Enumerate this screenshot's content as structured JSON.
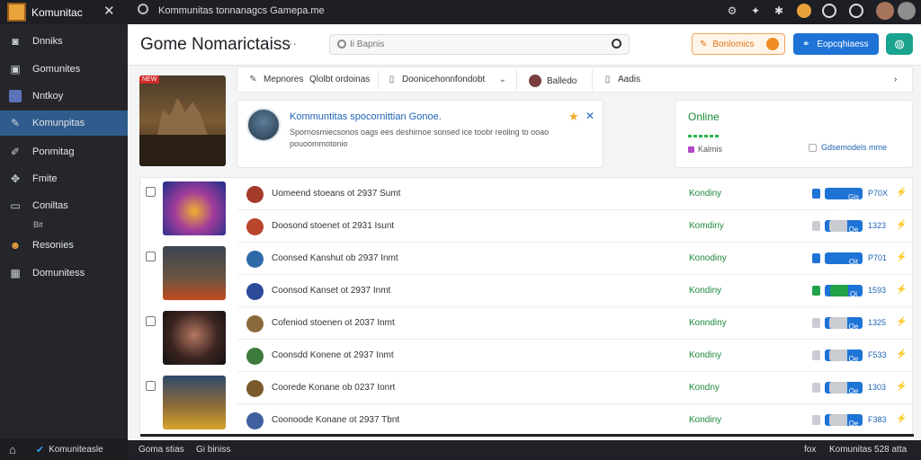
{
  "topbar": {
    "app_name": "Komunitac",
    "title": "Kommunitas tonnanagcs Gamepa.me"
  },
  "sidebar": {
    "items": [
      {
        "label": "Dnniks",
        "icon": "camera-icon"
      },
      {
        "label": "Gomunites",
        "icon": "tv-icon"
      },
      {
        "label": "Nntkoy",
        "icon": "image-icon"
      },
      {
        "label": "Komunpitas",
        "icon": "wrench-icon"
      },
      {
        "label": "Ponmitag",
        "icon": "pen-icon"
      },
      {
        "label": "Fmite",
        "icon": "gamepad-icon"
      },
      {
        "label": "Coniltas",
        "icon": "chat-icon"
      },
      {
        "label": "Resonies",
        "icon": "people-icon"
      },
      {
        "label": "Domunitess",
        "icon": "grid-icon"
      }
    ],
    "sub_label": "Bit",
    "footer_label": "Komuniteasle"
  },
  "bottombar": {
    "left1": "Goma stias",
    "left2": "Gi biniss",
    "right1": "fox",
    "right2": "Komunitas 528 atta"
  },
  "header": {
    "title": "Gome Nomarictaiss",
    "dots": "···",
    "search_placeholder": "Ii Bapnis",
    "btn_orange": "Bonlomics",
    "btn_blue": "Eopcqhiaess"
  },
  "featured": {
    "tag": "NEW"
  },
  "strip": {
    "items": [
      "Mepnores",
      "Qlolbt ordoinas",
      "Doonicehonnfondobt",
      "Balledo",
      "Aadis"
    ]
  },
  "notification": {
    "title": "Kommuntitas spocornittian Gonoe.",
    "body": "Spornosmiecsonos oags ees deshirnoe sonsed ice toobr reoling to ooao pouoommotonio"
  },
  "online": {
    "title": "Online",
    "sub": "Kalmis",
    "right": "Gdsemodels mme"
  },
  "rows": [
    {
      "text": "Uomeend stoeans ot 2937 Sumt",
      "status": "Kondiny",
      "num": "P70X",
      "badge": "Gis tato",
      "c": "blue"
    },
    {
      "text": "Doosond stoenet ot 2931 Isunt",
      "status": "Komdiriy",
      "num": "1323",
      "badge": "Oe",
      "c": "grey"
    },
    {
      "text": "Coonsed Kanshut ob 2937 Inmt",
      "status": "Konodiny",
      "num": "P701",
      "badge": "Oit noris",
      "c": "blue"
    },
    {
      "text": "Coonsod Kanset ot 2937 Inmt",
      "status": "Kondiny",
      "num": "1593",
      "badge": "Oi Eie",
      "c": "green"
    },
    {
      "text": "Cofeniod stoenen ot 2037 Inmt",
      "status": "Konndiny",
      "num": "1325",
      "badge": "Oe",
      "c": "grey"
    },
    {
      "text": "Coonsdd Konene ot 2937 Inmt",
      "status": "Kondiny",
      "num": "F533",
      "badge": "Oe",
      "c": "grey"
    },
    {
      "text": "Coorede Konane ob 0237 Ionrt",
      "status": "Kondny",
      "num": "1303",
      "badge": "Oe",
      "c": "grey"
    },
    {
      "text": "Coonoode Konane ot 2937 Tbnt",
      "status": "Kondiny",
      "num": "F383",
      "badge": "Oe",
      "c": "grey"
    }
  ],
  "colors": {
    "sidebar_active": "#2f5c8c",
    "accent_blue": "#1e73d6",
    "status_green": "#1d8a3a",
    "orange": "#f08a24"
  }
}
